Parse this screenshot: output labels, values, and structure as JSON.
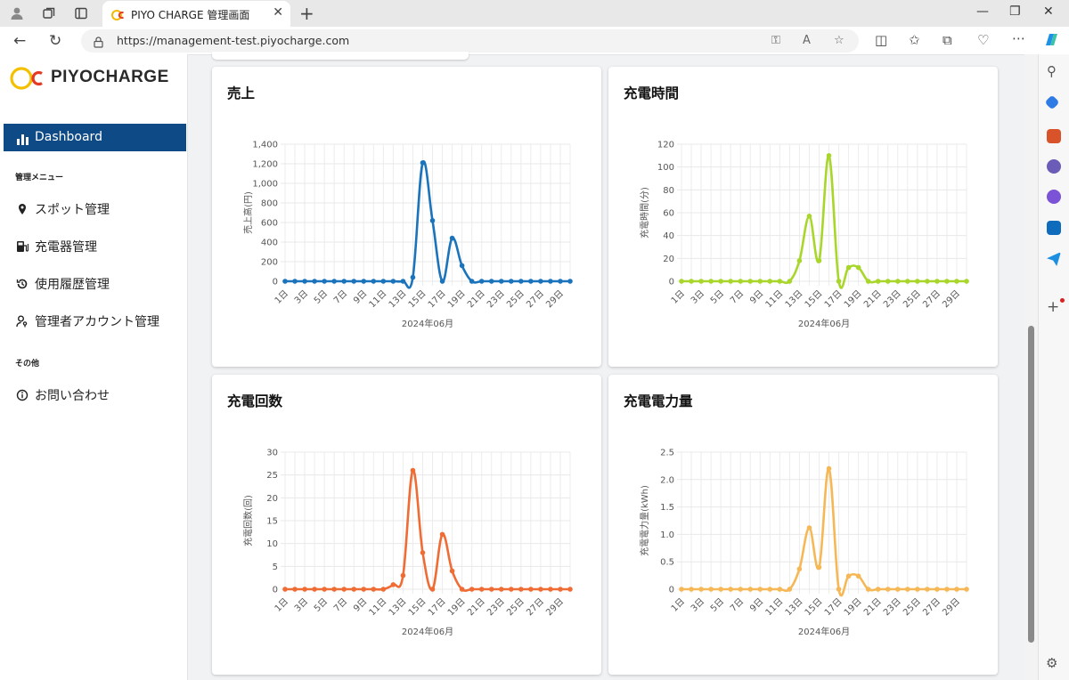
{
  "browser": {
    "tab_title": "PIYO CHARGE 管理画面",
    "url": "https://management-test.piyocharge.com"
  },
  "sidebar": {
    "logo_text": "PIYOCHARGE",
    "active_item": "Dashboard",
    "section_admin": "管理メニュー",
    "items_admin": [
      {
        "label": "スポット管理",
        "icon": "map-pin-icon"
      },
      {
        "label": "充電器管理",
        "icon": "charger-icon"
      },
      {
        "label": "使用履歴管理",
        "icon": "history-icon"
      },
      {
        "label": "管理者アカウント管理",
        "icon": "user-key-icon"
      }
    ],
    "section_other": "その他",
    "items_other": [
      {
        "label": "お問い合わせ",
        "icon": "info-icon"
      }
    ]
  },
  "cards": [
    {
      "title": "売上"
    },
    {
      "title": "充電時間"
    },
    {
      "title": "充電回数"
    },
    {
      "title": "充電電力量"
    }
  ],
  "chart_data": [
    {
      "type": "line",
      "xlabel": "2024年06月",
      "ylabel": "売上高(円)",
      "ylim": [
        0,
        1400
      ],
      "yticks": [
        0,
        200,
        400,
        600,
        800,
        1000,
        1200,
        1400
      ],
      "ytick_labels": [
        "0",
        "200",
        "400",
        "600",
        "800",
        "1,000",
        "1,200",
        "1,400"
      ],
      "x": [
        "1日",
        "2日",
        "3日",
        "4日",
        "5日",
        "6日",
        "7日",
        "8日",
        "9日",
        "10日",
        "11日",
        "12日",
        "13日",
        "14日",
        "15日",
        "16日",
        "17日",
        "18日",
        "19日",
        "20日",
        "21日",
        "22日",
        "23日",
        "24日",
        "25日",
        "26日",
        "27日",
        "28日",
        "29日",
        "30日"
      ],
      "xtick_labels": [
        "1日",
        "3日",
        "5日",
        "7日",
        "9日",
        "11日",
        "13日",
        "15日",
        "17日",
        "19日",
        "21日",
        "23日",
        "25日",
        "27日",
        "29日"
      ],
      "series": [
        {
          "values": [
            0,
            0,
            0,
            0,
            0,
            0,
            0,
            0,
            0,
            0,
            0,
            0,
            0,
            40,
            1210,
            620,
            0,
            440,
            160,
            0,
            0,
            0,
            0,
            0,
            0,
            0,
            0,
            0,
            0,
            0
          ],
          "color": "#1a73bb"
        }
      ],
      "grid": true
    },
    {
      "type": "line",
      "xlabel": "2024年06月",
      "ylabel": "充電時間(分)",
      "ylim": [
        0,
        120
      ],
      "yticks": [
        0,
        20,
        40,
        60,
        80,
        100,
        120
      ],
      "ytick_labels": [
        "0",
        "20",
        "40",
        "60",
        "80",
        "100",
        "120"
      ],
      "x": [
        "1日",
        "2日",
        "3日",
        "4日",
        "5日",
        "6日",
        "7日",
        "8日",
        "9日",
        "10日",
        "11日",
        "12日",
        "13日",
        "14日",
        "15日",
        "16日",
        "17日",
        "18日",
        "19日",
        "20日",
        "21日",
        "22日",
        "23日",
        "24日",
        "25日",
        "26日",
        "27日",
        "28日",
        "29日",
        "30日"
      ],
      "xtick_labels": [
        "1日",
        "3日",
        "5日",
        "7日",
        "9日",
        "11日",
        "13日",
        "15日",
        "17日",
        "19日",
        "21日",
        "23日",
        "25日",
        "27日",
        "29日"
      ],
      "series": [
        {
          "values": [
            0,
            0,
            0,
            0,
            0,
            0,
            0,
            0,
            0,
            0,
            0,
            0,
            18,
            57,
            18,
            110,
            0,
            12,
            12,
            0,
            0,
            0,
            0,
            0,
            0,
            0,
            0,
            0,
            0,
            0
          ],
          "color": "#a8d62a"
        }
      ],
      "grid": true
    },
    {
      "type": "line",
      "xlabel": "2024年06月",
      "ylabel": "充電回数(回)",
      "ylim": [
        0,
        30
      ],
      "yticks": [
        0,
        5,
        10,
        15,
        20,
        25,
        30
      ],
      "ytick_labels": [
        "0",
        "5",
        "10",
        "15",
        "20",
        "25",
        "30"
      ],
      "x": [
        "1日",
        "2日",
        "3日",
        "4日",
        "5日",
        "6日",
        "7日",
        "8日",
        "9日",
        "10日",
        "11日",
        "12日",
        "13日",
        "14日",
        "15日",
        "16日",
        "17日",
        "18日",
        "19日",
        "20日",
        "21日",
        "22日",
        "23日",
        "24日",
        "25日",
        "26日",
        "27日",
        "28日",
        "29日",
        "30日"
      ],
      "xtick_labels": [
        "1日",
        "3日",
        "5日",
        "7日",
        "9日",
        "11日",
        "13日",
        "15日",
        "17日",
        "19日",
        "21日",
        "23日",
        "25日",
        "27日",
        "29日"
      ],
      "series": [
        {
          "values": [
            0,
            0,
            0,
            0,
            0,
            0,
            0,
            0,
            0,
            0,
            0,
            1,
            3,
            26,
            8,
            0,
            12,
            4,
            0,
            0,
            0,
            0,
            0,
            0,
            0,
            0,
            0,
            0,
            0,
            0
          ],
          "color": "#ef6c35"
        }
      ],
      "grid": true
    },
    {
      "type": "line",
      "xlabel": "2024年06月",
      "ylabel": "充電電力量(kWh)",
      "ylim": [
        0,
        2.5
      ],
      "yticks": [
        0,
        0.5,
        1.0,
        1.5,
        2.0,
        2.5
      ],
      "ytick_labels": [
        "0",
        "0.5",
        "1.0",
        "1.5",
        "2.0",
        "2.5"
      ],
      "x": [
        "1日",
        "2日",
        "3日",
        "4日",
        "5日",
        "6日",
        "7日",
        "8日",
        "9日",
        "10日",
        "11日",
        "12日",
        "13日",
        "14日",
        "15日",
        "16日",
        "17日",
        "18日",
        "19日",
        "20日",
        "21日",
        "22日",
        "23日",
        "24日",
        "25日",
        "26日",
        "27日",
        "28日",
        "29日",
        "30日"
      ],
      "xtick_labels": [
        "1日",
        "3日",
        "5日",
        "7日",
        "9日",
        "11日",
        "13日",
        "15日",
        "17日",
        "19日",
        "21日",
        "23日",
        "25日",
        "27日",
        "29日"
      ],
      "series": [
        {
          "values": [
            0,
            0,
            0,
            0,
            0,
            0,
            0,
            0,
            0,
            0,
            0,
            0,
            0.37,
            1.12,
            0.4,
            2.2,
            0,
            0.24,
            0.24,
            0,
            0,
            0,
            0,
            0,
            0,
            0,
            0,
            0,
            0,
            0
          ],
          "color": "#f6b856"
        }
      ],
      "grid": true
    }
  ]
}
